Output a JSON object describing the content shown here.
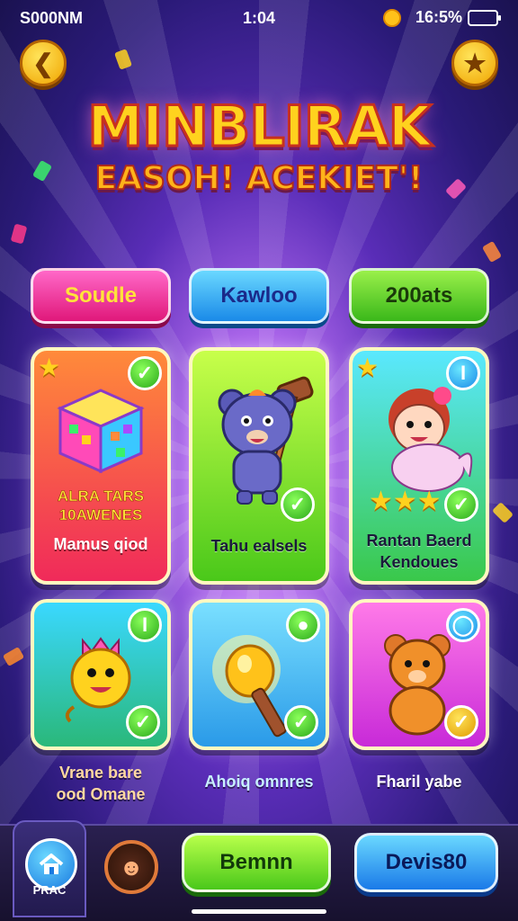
{
  "status_bar": {
    "carrier": "S000NM",
    "time": "1:04",
    "battery": "16:5%"
  },
  "title": "MINBLIRAK",
  "subtitle": "EASOH! ACEKIET'!",
  "tabs": [
    {
      "label": "Soudle"
    },
    {
      "label": "Kawloo"
    },
    {
      "label": "200ats"
    }
  ],
  "cards": [
    {
      "sub_line1": "ALRA TARS",
      "sub_line2": "10AWENES",
      "title": "Mamus qiod"
    },
    {
      "title": "Tahu ealsels"
    },
    {
      "title_line1": "Rantan Baerd",
      "title_line2": "Kendoues"
    }
  ],
  "bottom_cards": [
    {
      "label_line1": "Vrane bare",
      "label_line2": "ood Omane"
    },
    {
      "label": "Ahoiq omnres"
    },
    {
      "label": "Fharil yabe"
    }
  ],
  "nav": {
    "home_label": "PRAC",
    "green_button": "Bemnn",
    "blue_button": "Devis80"
  },
  "colors": {
    "accent_yellow": "#ffd21e",
    "pink": "#e0187a",
    "blue": "#1a8ae8",
    "green": "#4ac81a"
  },
  "icons": [
    "back-arrow-icon",
    "star-icon",
    "coin-icon",
    "battery-icon",
    "check-icon",
    "home-icon",
    "avatar-icon"
  ]
}
